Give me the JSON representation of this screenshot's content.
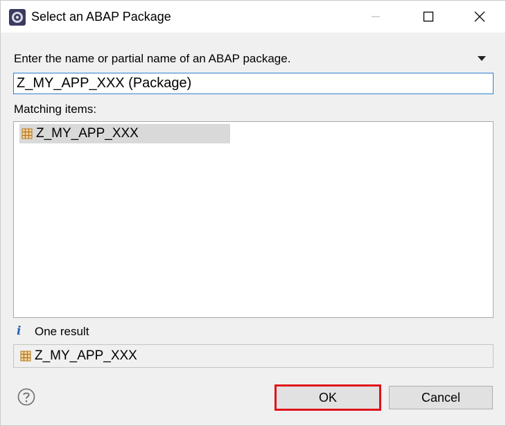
{
  "window": {
    "title": "Select an ABAP Package",
    "app_icon": "eclipse-gear-icon",
    "controls": [
      "minimize-icon",
      "maximize-icon",
      "close-icon"
    ]
  },
  "search": {
    "prompt": "Enter the name or partial name of an ABAP package.",
    "value": "Z_MY_APP_XXX (Package)",
    "history_icon": "dropdown-triangle-icon"
  },
  "matching": {
    "label": "Matching items:",
    "items": [
      {
        "label": "Z_MY_APP_XXX",
        "icon": "package-icon",
        "selected": true
      }
    ]
  },
  "status": {
    "icon": "info-icon",
    "text": "One result"
  },
  "detail": {
    "icon": "package-icon",
    "text": "Z_MY_APP_XXX"
  },
  "buttons": {
    "help_icon": "help-icon",
    "ok": "OK",
    "cancel": "Cancel",
    "highlight_color": "#e0101a"
  }
}
